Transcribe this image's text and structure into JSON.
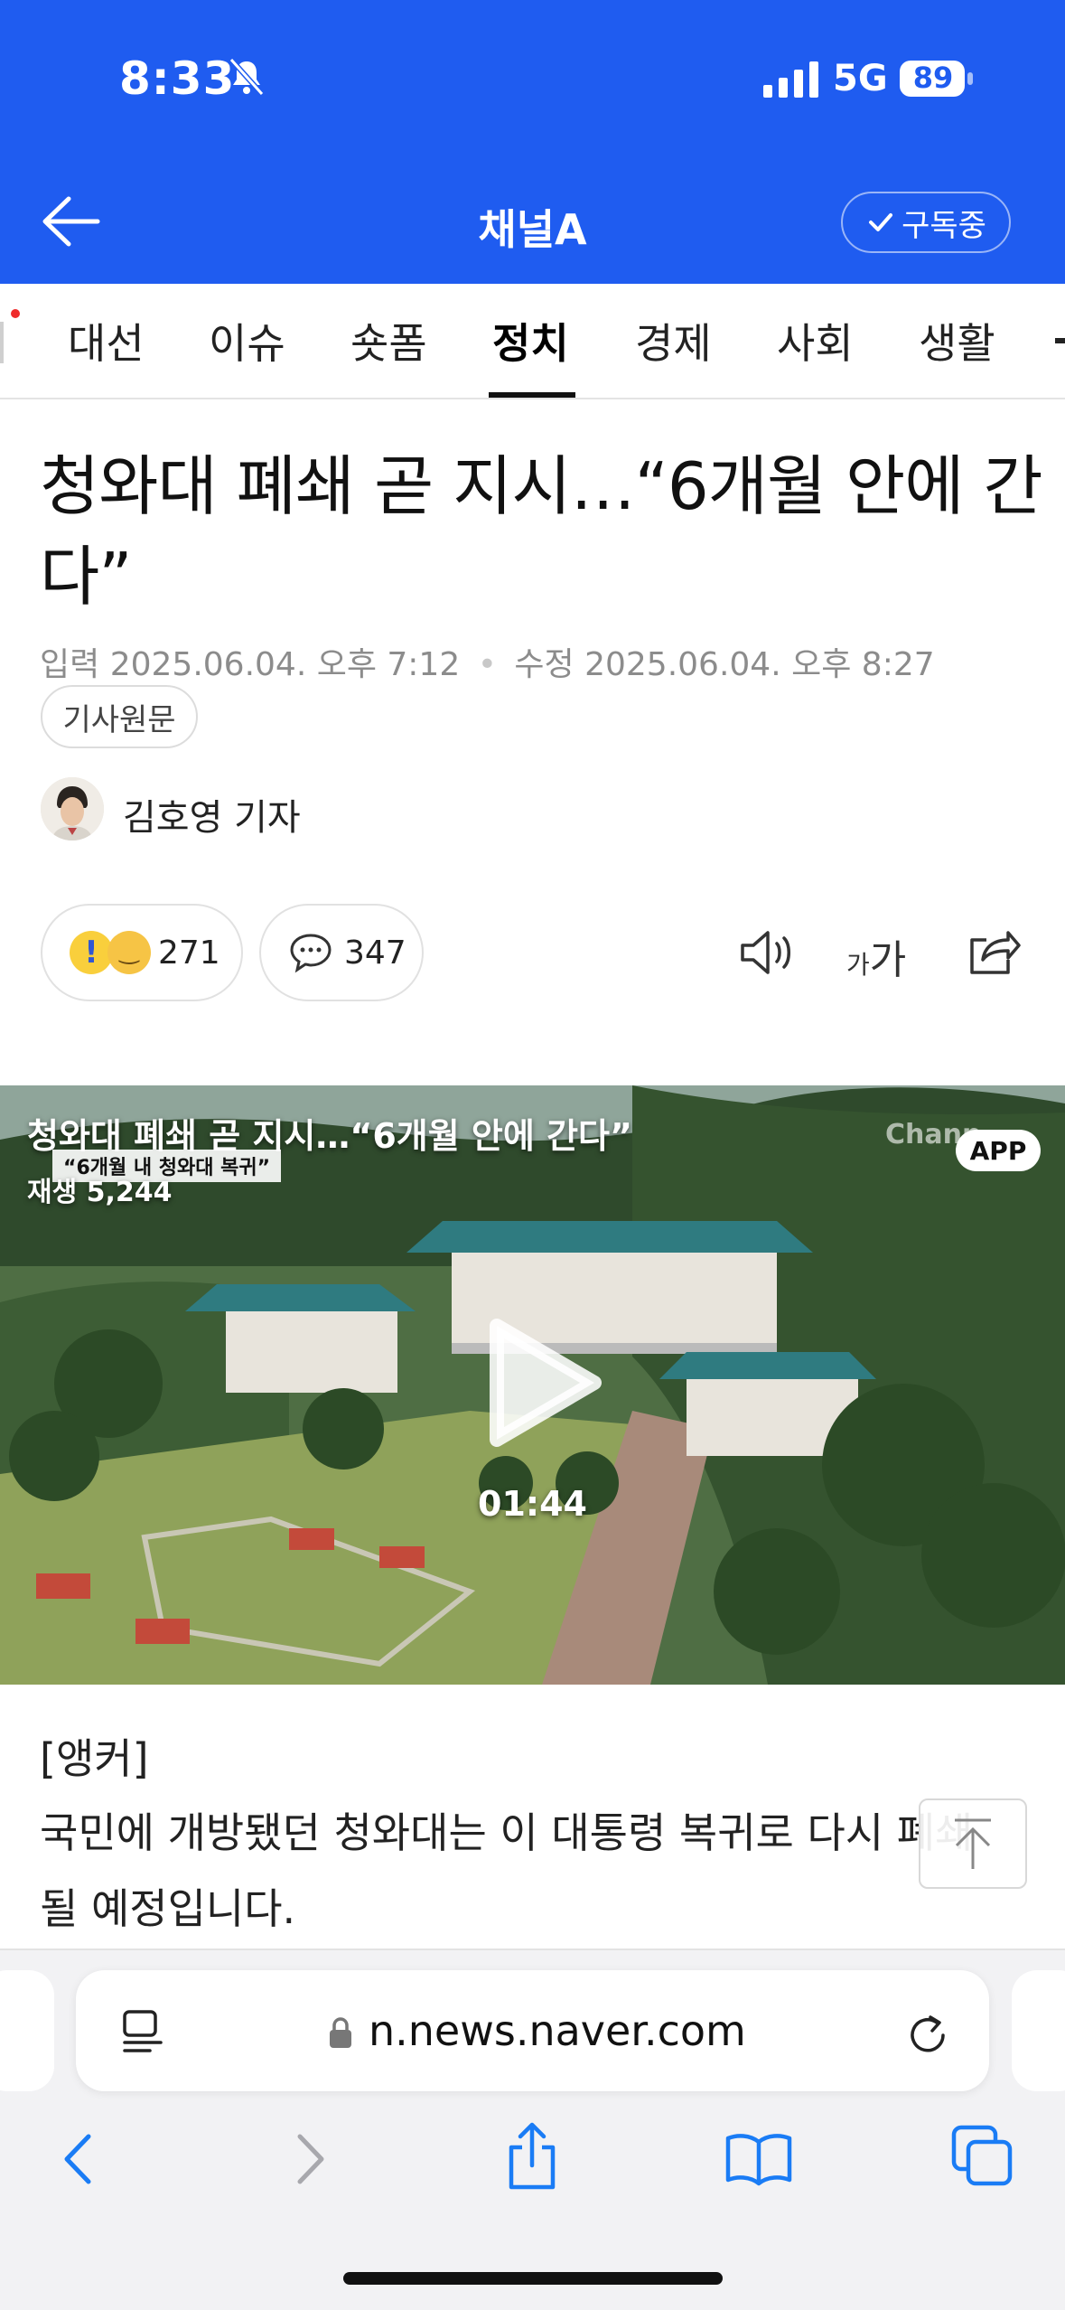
{
  "status_bar": {
    "time": "8:33",
    "network": "5G",
    "battery": "89"
  },
  "header": {
    "title": "채널A",
    "subscribe_label": "구독중"
  },
  "tabs": [
    {
      "label": "대선"
    },
    {
      "label": "이슈"
    },
    {
      "label": "숏폼"
    },
    {
      "label": "정치"
    },
    {
      "label": "경제"
    },
    {
      "label": "사회"
    },
    {
      "label": "생활"
    }
  ],
  "active_tab": "정치",
  "article": {
    "headline": "청와대 폐쇄 곧 지시…“6개월 안에 간다”",
    "input_label": "입력",
    "input_date": "2025.06.04. 오후 7:12",
    "edit_label": "수정",
    "edit_date": "2025.06.04. 오후 8:27",
    "origin_button": "기사원문",
    "reporter": "김호영 기자",
    "reaction_count": "271",
    "comment_count": "347",
    "fontsize_label_small": "가",
    "fontsize_label_large": "가"
  },
  "video": {
    "title": "청와대 폐쇄 곧 지시…“6개월 안에 간다”",
    "caption": "“6개월 내 청와대 복귀”",
    "plays": "재생 5,244",
    "logo": "Chann",
    "app_badge": "APP",
    "duration": "01:44"
  },
  "body": {
    "anchor": "[앵커]",
    "text": "국민에 개방됐던 청와대는 이 대통령 복귀로 다시 폐쇄될 예정입니다."
  },
  "browser": {
    "url": "n.news.naver.com"
  },
  "colors": {
    "brand_blue": "#1f5cf0",
    "safari_blue": "#1a7cf5"
  }
}
